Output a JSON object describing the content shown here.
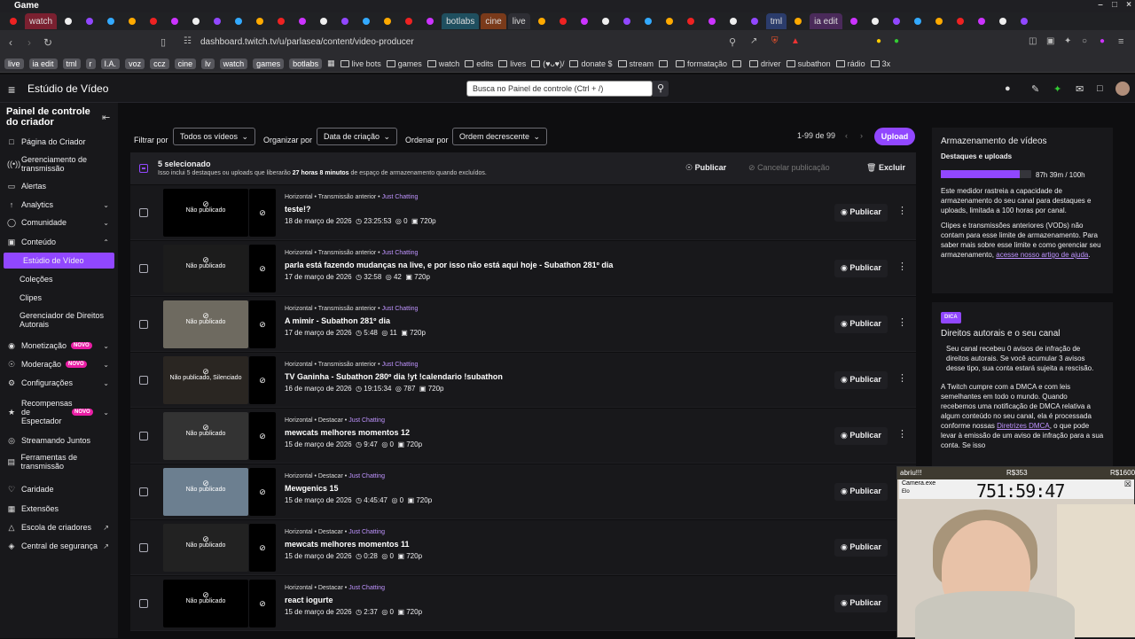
{
  "titlebar": {
    "title": "Game"
  },
  "tabs": [
    "",
    "watch",
    "",
    "",
    "",
    "",
    "",
    "",
    "",
    "",
    "",
    "",
    "",
    "",
    "",
    "",
    "",
    "",
    "",
    "",
    "botlabs",
    "cine",
    "live",
    "",
    "",
    "",
    "",
    "",
    "",
    "",
    "",
    "",
    "",
    "",
    "tml",
    "",
    "ia edit",
    "",
    "",
    "",
    "",
    "",
    "",
    "",
    "",
    ""
  ],
  "address": {
    "url": "dashboard.twitch.tv/u/parlasea/content/video-producer"
  },
  "bookmarks": {
    "chips": [
      "live",
      "ia edit",
      "tml",
      "r",
      "I.A.",
      "voz",
      "ccz",
      "cine",
      "lv",
      "watch",
      "games",
      "botlabs"
    ],
    "folders": [
      "live bots",
      "games",
      "watch",
      "edits",
      "lives",
      "(♥ᴗ♥)/",
      "donate $",
      "stream",
      "",
      "formatação",
      "",
      "driver",
      "subathon",
      "rádio",
      "3x"
    ]
  },
  "topnav": {
    "studio": "Estúdio de Vídeo",
    "search_placeholder": "Busca no Painel de controle (Ctrl + /)"
  },
  "sidebar": {
    "title": "Painel de controle do criador",
    "items": [
      {
        "label": "Página do Criador"
      },
      {
        "label": "Gerenciamento de transmissão"
      },
      {
        "label": "Alertas"
      },
      {
        "label": "Analytics"
      },
      {
        "label": "Comunidade"
      },
      {
        "label": "Conteúdo"
      },
      {
        "label": "Estúdio de Vídeo"
      },
      {
        "label": "Coleções"
      },
      {
        "label": "Clipes"
      },
      {
        "label": "Gerenciador de Direitos Autorais"
      },
      {
        "label": "Monetização",
        "badge": "NOVO"
      },
      {
        "label": "Moderação",
        "badge": "NOVO"
      },
      {
        "label": "Configurações"
      },
      {
        "label": "Recompensas de Espectador",
        "badge": "NOVO"
      },
      {
        "label": "Streamando Juntos"
      },
      {
        "label": "Ferramentas de transmissão"
      },
      {
        "label": "Caridade"
      },
      {
        "label": "Extensões"
      },
      {
        "label": "Escola de criadores"
      },
      {
        "label": "Central de segurança"
      }
    ]
  },
  "filters": {
    "filter_label": "Filtrar por",
    "filter_value": "Todos os vídeos",
    "group_label": "Organizar por",
    "group_value": "Data de criação",
    "sort_label": "Ordenar por",
    "sort_value": "Ordem decrescente",
    "range": "1-99 de 99",
    "upload": "Upload"
  },
  "selection": {
    "title": "5 selecionado",
    "note_pre": "Isso inclui 5 destaques ou uploads que liberarão ",
    "note_bold": "27 horas 8 minutos",
    "note_post": " de espaço de armazenamento quando excluídos.",
    "publish": "Publicar",
    "unpublish": "Cancelar publicação",
    "delete": "Excluir"
  },
  "videos": [
    {
      "type": "Horizontal • Transmissão anterior • ",
      "category": "Just Chatting",
      "title": "teste!?",
      "date": "18 de março de 2026",
      "duration": "23:25:53",
      "views": "0",
      "quality": "720p",
      "status": "Não publicado",
      "publish": "Publicar"
    },
    {
      "type": "Horizontal • Transmissão anterior • ",
      "category": "Just Chatting",
      "title": "parla está fazendo mudanças na live, e por isso não está aqui hoje - Subathon 281º dia",
      "date": "17 de março de 2026",
      "duration": "32:58",
      "views": "42",
      "quality": "720p",
      "status": "Não publicado",
      "publish": "Publicar"
    },
    {
      "type": "Horizontal • Transmissão anterior • ",
      "category": "Just Chatting",
      "title": "A mimir - Subathon 281º dia",
      "date": "17 de março de 2026",
      "duration": "5:48",
      "views": "11",
      "quality": "720p",
      "status": "Não publicado",
      "publish": "Publicar"
    },
    {
      "type": "Horizontal • Transmissão anterior • ",
      "category": "Just Chatting",
      "title": "TV Ganinha - Subathon 280º dia !yt !calendario !subathon",
      "date": "16 de março de 2026",
      "duration": "19:15:34",
      "views": "787",
      "quality": "720p",
      "status": "Não publicado, Silenciado",
      "publish": "Publicar"
    },
    {
      "type": "Horizontal • Destacar • ",
      "category": "Just Chatting",
      "title": "mewcats melhores momentos 12",
      "date": "15 de março de 2026",
      "duration": "9:47",
      "views": "0",
      "quality": "720p",
      "status": "Não publicado",
      "publish": "Publicar"
    },
    {
      "type": "Horizontal • Destacar • ",
      "category": "Just Chatting",
      "title": "Mewgenics 15",
      "date": "15 de março de 2026",
      "duration": "4:45:47",
      "views": "0",
      "quality": "720p",
      "status": "Não publicado",
      "publish": "Publicar"
    },
    {
      "type": "Horizontal • Destacar • ",
      "category": "Just Chatting",
      "title": "mewcats melhores momentos 11",
      "date": "15 de março de 2026",
      "duration": "0:28",
      "views": "0",
      "quality": "720p",
      "status": "Não publicado",
      "publish": "Publicar"
    },
    {
      "type": "Horizontal • Destacar • ",
      "category": "Just Chatting",
      "title": "react iogurte",
      "date": "15 de março de 2026",
      "duration": "2:37",
      "views": "0",
      "quality": "720p",
      "status": "Não publicado",
      "publish": "Publicar"
    }
  ],
  "storage": {
    "title": "Armazenamento de vídeos",
    "subtitle": "Destaques e uploads",
    "used": "87h 39m / 100h",
    "fraction": 0.8765,
    "p1": "Este medidor rastreia a capacidade de armazenamento do seu canal para destaques e uploads, limitada a 100 horas por canal.",
    "p2": "Clipes e transmissões anteriores (VODs) não contam para esse limite de armazenamento. Para saber mais sobre esse limite e como gerenciar seu armazenamento, ",
    "p2_link": "acesse nosso artigo de ajuda",
    "p2_end": "."
  },
  "copyright": {
    "badge": "DICA",
    "title": "Direitos autorais e o seu canal",
    "p1": "Seu canal recebeu 0 avisos de infração de direitos autorais. Se você acumular 3 avisos desse tipo, sua conta estará sujeita a rescisão.",
    "p2": "A Twitch cumpre com a DMCA e com leis semelhantes em todo o mundo. Quando recebemos uma notificação de DMCA relativa a algum conteúdo no seu canal, ela é processada conforme nossas ",
    "p2_link": "Diretrizes DMCA",
    "p2_end": ", o que pode levar à emissão de um aviso de infração para a sua conta. Se isso"
  },
  "overlay": {
    "label": "abriu!!!",
    "goal_a": "R$353",
    "goal_b": "R$1600",
    "window": "Camera.exe",
    "timer": "751:59:47",
    "tiny": "Elo"
  }
}
